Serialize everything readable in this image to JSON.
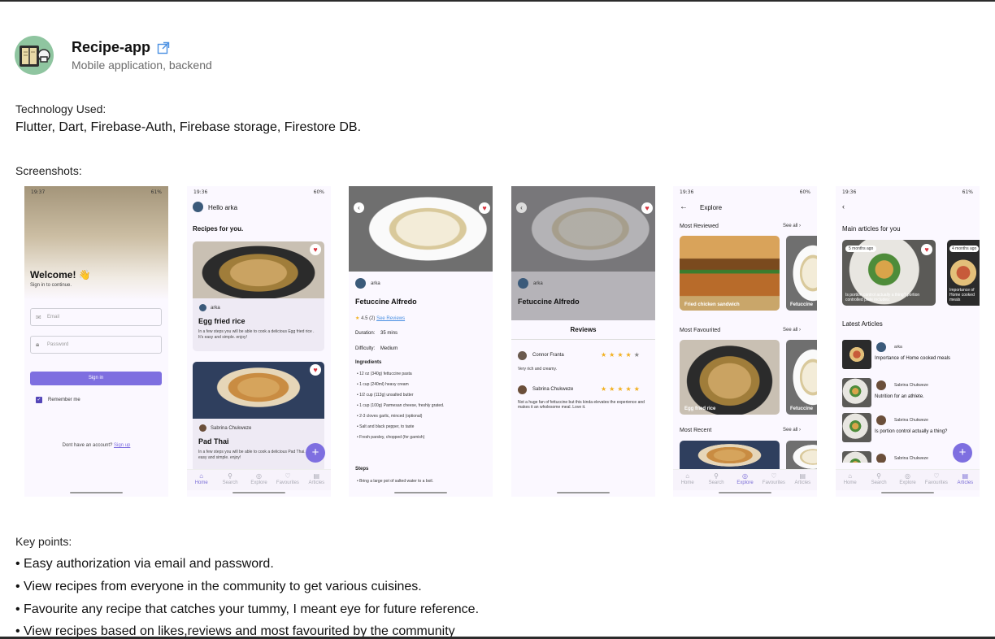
{
  "project": {
    "title": "Recipe-app",
    "subtitle": "Mobile application, backend"
  },
  "technology": {
    "label": "Technology Used:",
    "list": "Flutter, Dart, Firebase-Auth, Firebase storage, Firestore DB."
  },
  "screenshots": {
    "label": "Screenshots:",
    "nav": [
      "Home",
      "Search",
      "Explore",
      "Favourites",
      "Articles"
    ],
    "login": {
      "time": "19:37",
      "battery": "61%",
      "welcome": "Welcome! 👋",
      "signin_sub": "Sign in to continue.",
      "email_placeholder": "Email",
      "password_placeholder": "Password",
      "signin_button": "Sign in",
      "remember": "Remember me",
      "no_account": "Dont have an account?",
      "signup": "Sign up"
    },
    "home": {
      "time": "19:36",
      "battery": "60%",
      "greeting": "Hello arka",
      "section": "Recipes for you.",
      "card1_author": "arka",
      "card1_title": "Egg fried rice",
      "card1_desc": "In a few steps you will be able to cook a delicious Egg fried rice . It's easy and simple. enjoy!",
      "card2_author": "Sabrina Chukweze",
      "card2_title": "Pad Thai",
      "card2_desc": "In a few steps you will be able to cook a delicious Pad Thai. It's easy and simple. enjoy!"
    },
    "detail": {
      "author": "arka",
      "title": "Fetuccine Alfredo",
      "rating": "4.5",
      "rating_count": "(2)",
      "see_reviews": "See Reviews",
      "duration_label": "Duration:",
      "duration_value": "35 mins",
      "difficulty_label": "Difficulty:",
      "difficulty_value": "Medium",
      "ingredients_label": "Ingredients",
      "ingredients": [
        "12 oz (340g) fettuccine pasta",
        "1 cup (240ml) heavy cream",
        "1/2 cup (113g) unsalted butter",
        "1 cup (100g) Parmesan cheese, freshly grated.",
        "2-3 cloves garlic, minced (optional)",
        "Salt and black pepper, to taste",
        "Fresh parsley, chopped (for garnish)"
      ],
      "steps_label": "Steps",
      "step1": "Bring a large pot of salted water to a boil."
    },
    "reviews": {
      "author": "arka",
      "title": "Fetuccine Alfredo",
      "header": "Reviews",
      "r1_name": "Connor Franta",
      "r1_text": "Very rich and creamy.",
      "r1_stars": 4,
      "r2_name": "Sabrina Chukweze",
      "r2_text": "Not a huge fan of fettuccine but this kinda elevates the experience and makes it an wholesome meal. Love it.",
      "r2_stars": 5
    },
    "explore": {
      "time": "19:36",
      "battery": "60%",
      "title": "Explore",
      "most_reviewed": "Most Reviewed",
      "most_favourited": "Most Favourited",
      "most_recent": "Most Recent",
      "see_all": "See all",
      "card_burger": "Fried chicken sandwich",
      "card_fettuccine": "Fetuccine",
      "card_rice": "Egg fried rice"
    },
    "articles": {
      "time": "19:36",
      "battery": "61%",
      "main_title": "Main articles for you",
      "chip1": "5 months ago",
      "chip2": "4 months ago",
      "feature1": "Is portion control actually a thing?",
      "feature1_sub": "portion controlled plate includes:",
      "feature2": "Importance of Home cooked meals",
      "latest": "Latest Articles",
      "items": [
        {
          "author": "arka",
          "title": "Importance of Home cooked meals"
        },
        {
          "author": "Sabrina Chukweze",
          "title": "Nutrition for an athlete."
        },
        {
          "author": "Sabrina Chukweze",
          "title": "Is portion control actually a thing?"
        },
        {
          "author": "Sabrina Chukweze",
          "title": ""
        }
      ]
    }
  },
  "key_points": {
    "label": "Key points:",
    "items": [
      "• Easy authorization via email and password.",
      "• View recipes from everyone in the community to get various cuisines.",
      "• Favourite any recipe that catches your tummy, I meant eye for future reference.",
      "• View recipes based on likes,reviews and most favourited by the community"
    ]
  },
  "colors": {
    "accent": "#7e6fe0",
    "heart": "#d8343f",
    "star": "#f2b01e",
    "link": "#4a90e2"
  }
}
